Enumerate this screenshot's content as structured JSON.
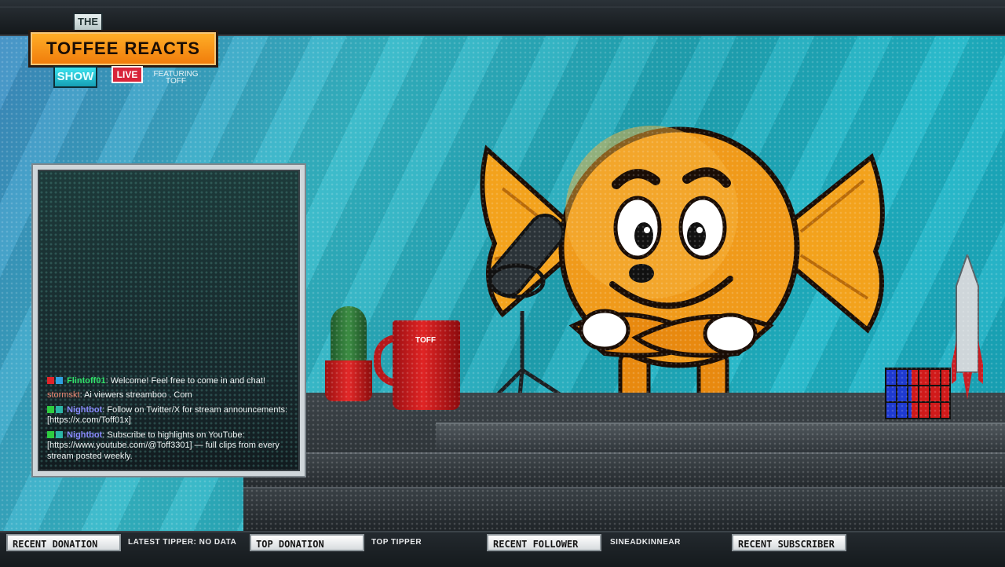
{
  "logo": {
    "the": "THE",
    "title": "TOFFEE REACTS",
    "show": "SHOW",
    "live": "LIVE",
    "featuring_line1": "FEATURING",
    "featuring_line2": "TOFF"
  },
  "mug_text": "TOFF",
  "chat": {
    "messages": [
      {
        "user": "Flintoff01",
        "text": "Welcome! Feel free to come in and chat!",
        "user_color": "#31e36a"
      },
      {
        "user": "stormskt",
        "text": "Ai viewers streamboo . Com",
        "user_color": "#f08a75"
      },
      {
        "user": "Nightbot",
        "text": "Follow on Twitter/X for stream announcements: [https://x.com/Toff01x]",
        "user_color": "#8a8cff"
      },
      {
        "user": "Nightbot",
        "text": "Subscribe to highlights on YouTube: [https://www.youtube.com/@Toff3301] — full clips from every stream posted weekly.",
        "user_color": "#8a8cff"
      }
    ]
  },
  "bottom_bar": {
    "recent_donation_label": "RECENT DONATION",
    "latest_tipper_text": "LATEST TIPPER: NO DATA",
    "top_donation_label": "TOP DONATION",
    "top_tipper_text": "TOP TIPPER",
    "recent_follower_label": "RECENT FOLLOWER",
    "recent_follower_name": "SINEADKINNEAR",
    "recent_subscriber_label": "RECENT SUBSCRIBER"
  },
  "colors": {
    "accent_orange": "#f5941a",
    "accent_cyan": "#2cc7d6",
    "live_red": "#d8243a"
  },
  "icons": [
    "microphone-icon",
    "cactus-icon",
    "mug-icon",
    "rubiks-cube-icon",
    "rocket-icon",
    "mascot-candy-icon"
  ]
}
